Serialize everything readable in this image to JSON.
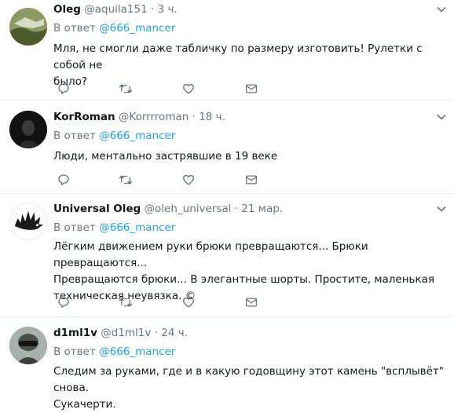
{
  "reply_prefix": "В ответ",
  "tweets": [
    {
      "name": "Oleg",
      "handle": "@aquila151",
      "dot": "·",
      "time": "3 ч.",
      "mention": "@666_mancer",
      "lines": [
        "Мля, не смогли даже табличку по размеру изготовить! Рулетки с собой не",
        "было?"
      ]
    },
    {
      "name": "KorRoman",
      "handle": "@Korrrroman",
      "dot": "·",
      "time": "18 ч.",
      "mention": "@666_mancer",
      "lines": [
        "Люди, ментально застрявшие в 19 веке"
      ]
    },
    {
      "name": "Universal Oleg",
      "handle": "@oleh_universal",
      "dot": "·",
      "time": "21 мар.",
      "mention": "@666_mancer",
      "lines": [
        "Лёгким движением руки брюки превращаются... Брюки превращаются...",
        "Превращаются брюки... В элегантные шорты. Простите, маленькая",
        "техническая неувязка. ©"
      ]
    },
    {
      "name": "d1ml1v",
      "handle": "@d1ml1v",
      "dot": "·",
      "time": "24 ч.",
      "mention": "@666_mancer",
      "lines": [
        "Следим за руками, где и в какую годовщину этот камень \"всплывёт\" снова.",
        "Сукачерти."
      ]
    }
  ],
  "icons": [
    "reply-icon",
    "retweet-icon",
    "like-icon",
    "direct-message-icon",
    "chevron-down-icon"
  ],
  "colors": {
    "link": "#1da1f2",
    "secondary": "#657786",
    "icon": "#657786",
    "divider": "#e6ecf0"
  }
}
